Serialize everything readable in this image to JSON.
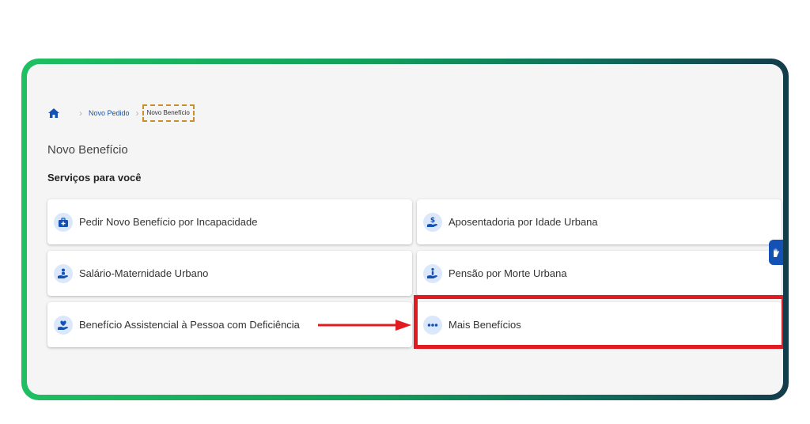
{
  "breadcrumb": {
    "home_icon": "home-icon",
    "items": [
      "Novo Pedido",
      "Novo Benefício"
    ]
  },
  "page_title": "Novo Benefício",
  "section_title": "Serviços para você",
  "services": [
    {
      "label": "Pedir Novo Benefício por Incapacidade",
      "icon": "medical-kit-icon"
    },
    {
      "label": "Aposentadoria por Idade Urbana",
      "icon": "hand-dollar-icon"
    },
    {
      "label": "Salário-Maternidade Urbano",
      "icon": "hand-baby-icon"
    },
    {
      "label": "Pensão por Morte Urbana",
      "icon": "hand-person-icon"
    },
    {
      "label": "Benefício Assistencial à Pessoa com Deficiência",
      "icon": "hand-heart-icon"
    },
    {
      "label": "Mais Benefícios",
      "icon": "more-dots-icon"
    }
  ],
  "colors": {
    "accent": "#1351b4",
    "icon_bg": "#dbe8fb",
    "highlight": "#e01b22",
    "dashed_border": "#c8912a"
  }
}
